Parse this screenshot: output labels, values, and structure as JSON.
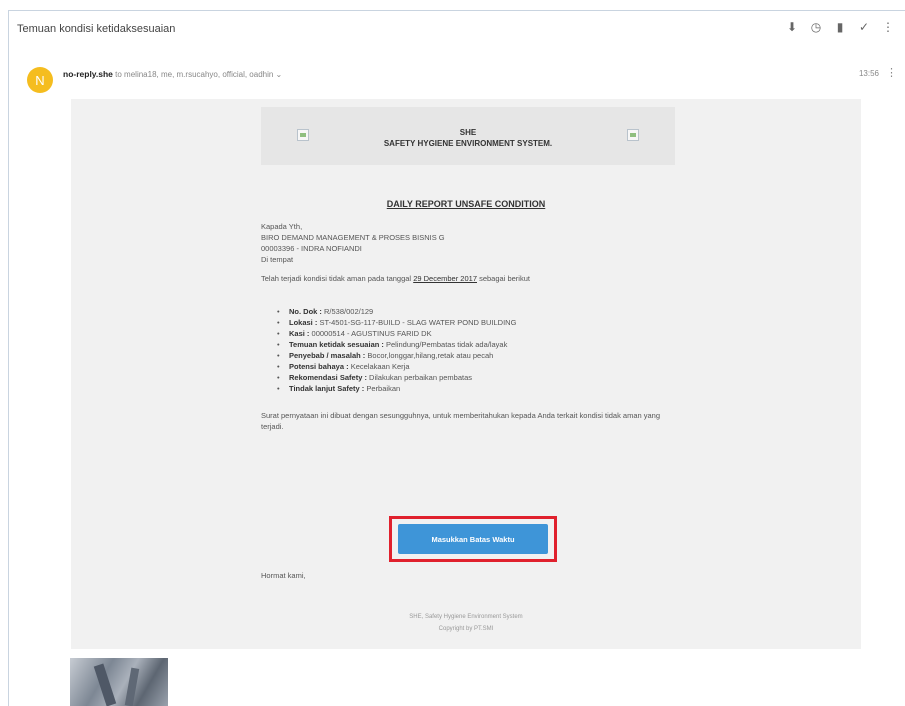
{
  "subject": "Temuan kondisi ketidaksesuaian",
  "toolbar": {
    "icons": [
      "pin-icon",
      "clock-icon",
      "trash-icon",
      "check-icon",
      "more-icon"
    ],
    "glyphs": [
      "⬇",
      "◷",
      "▮",
      "✓",
      "⋮"
    ]
  },
  "message": {
    "avatar_letter": "N",
    "sender": "no-reply.she",
    "recipients": "to melina18, me, m.rsucahyo, official, oadhin",
    "recipients_toggle": "⌄",
    "time": "13:56",
    "more": "⋮"
  },
  "email": {
    "header_line1": "SHE",
    "header_line2": "SAFETY HYGIENE ENVIRONMENT SYSTEM.",
    "report_title": "DAILY REPORT UNSAFE CONDITION",
    "greeting": "Kapada Yth,",
    "recipient_unit": "BIRO DEMAND MANAGEMENT & PROSES BISNIS G",
    "recipient_name": "00003396 - INDRA NOFIANDI",
    "recipient_place": "Di tempat",
    "intro_before": "Telah terjadi kondisi tidak aman pada tanggal",
    "intro_date": "29 December 2017",
    "intro_after": "sebagai berikut",
    "items": [
      {
        "label": "No. Dok :",
        "value": "R/538/002/129"
      },
      {
        "label": "Lokasi :",
        "value": "ST-4501-SG-117-BUILD - SLAG WATER POND BUILDING"
      },
      {
        "label": "Kasi :",
        "value": "00000514 - AGUSTINUS FARID DK"
      },
      {
        "label": "Temuan ketidak sesuaian :",
        "value": "Pelindung/Pembatas tidak ada/layak"
      },
      {
        "label": "Penyebab / masalah :",
        "value": "Bocor,longgar,hilang,retak atau pecah"
      },
      {
        "label": "Potensi bahaya :",
        "value": "Kecelakaan Kerja"
      },
      {
        "label": "Rekomendasi Safety :",
        "value": "Dilakukan perbaikan pembatas"
      },
      {
        "label": "Tindak lanjut Safety :",
        "value": "Perbaikan"
      }
    ],
    "closing": "Surat pernyataan ini dibuat dengan sesungguhnya, untuk memberitahukan kepada Anda terkait kondisi tidak aman yang terjadi.",
    "cta_label": "Masukkan Batas Waktu",
    "regards": "Hormat kami,",
    "footer_line1": "SHE, Safety Hygiene Environment System",
    "footer_line2": "Copyright by PT.SMI"
  },
  "colors": {
    "avatar": "#f5bd1f",
    "cta": "#3e95d8",
    "highlight_border": "#e0212d"
  }
}
